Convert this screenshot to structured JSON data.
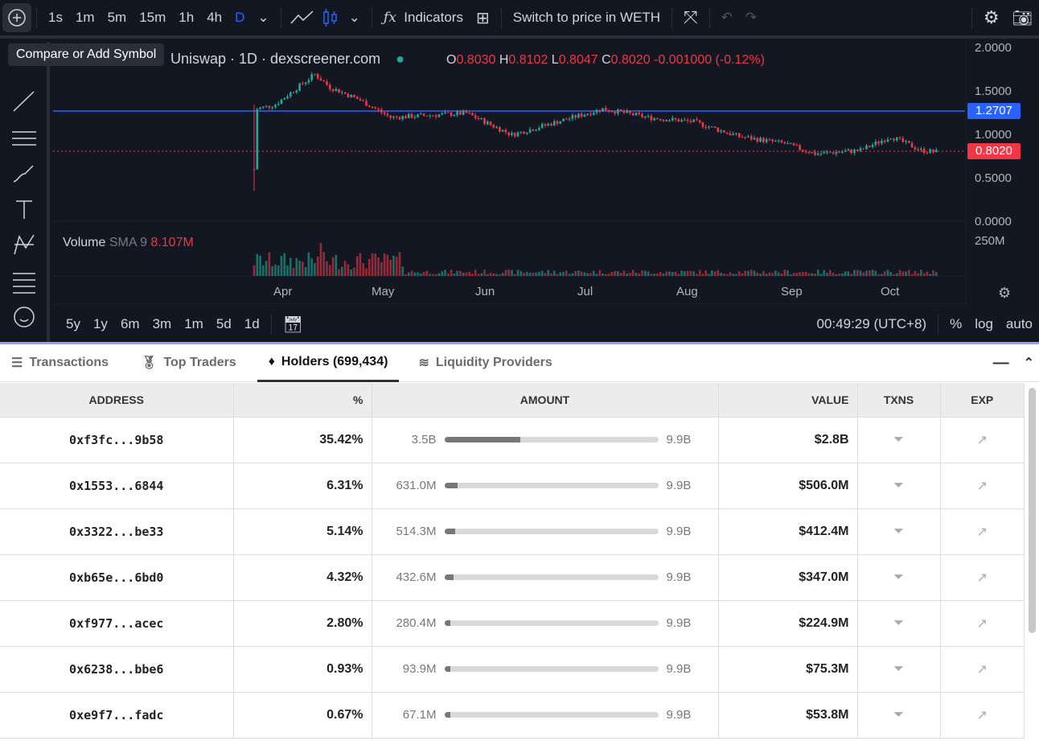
{
  "toolbar": {
    "intervals": [
      "1s",
      "1m",
      "5m",
      "15m",
      "1h",
      "4h",
      "D"
    ],
    "indicators": "Indicators",
    "switch_price": "Switch to price in WETH"
  },
  "tooltip": "Compare or Add Symbol",
  "legend": {
    "title": "Uniswap · 1D · dexscreener.com",
    "o_label": "O",
    "o": "0.8030",
    "h_label": "H",
    "h": "0.8102",
    "l_label": "L",
    "l": "0.8047",
    "c_label": "C",
    "c": "0.8020",
    "change": "-0.001000 (-0.12%)"
  },
  "price_axis": [
    "2.0000",
    "1.5000",
    "1.0000",
    "0.5000",
    "0.0000"
  ],
  "price_labels": {
    "line": "1.2707",
    "last": "0.8020"
  },
  "volume": {
    "label": "Volume",
    "sma": "SMA 9",
    "value": "8.107M",
    "axis": "250M"
  },
  "time_axis": [
    "Apr",
    "May",
    "Jun",
    "Jul",
    "Aug",
    "Sep",
    "Oct"
  ],
  "bottom_bar": {
    "ranges": [
      "5y",
      "1y",
      "6m",
      "3m",
      "1m",
      "5d",
      "1d"
    ],
    "clock": "00:49:29 (UTC+8)",
    "pct": "%",
    "log": "log",
    "auto": "auto"
  },
  "colors": {
    "up": "#26a69a",
    "down": "#f23645",
    "line": "#2962ff"
  },
  "chart_data": {
    "type": "candlestick",
    "keypoints_day_price": [
      [
        0,
        0.6
      ],
      [
        1,
        1.3
      ],
      [
        7,
        1.35
      ],
      [
        20,
        1.7
      ],
      [
        25,
        1.55
      ],
      [
        35,
        1.4
      ],
      [
        45,
        1.2
      ],
      [
        70,
        1.25
      ],
      [
        85,
        1.0
      ],
      [
        100,
        1.15
      ],
      [
        115,
        1.3
      ],
      [
        130,
        1.2
      ],
      [
        145,
        1.15
      ],
      [
        160,
        0.98
      ],
      [
        175,
        0.9
      ],
      [
        185,
        0.78
      ],
      [
        200,
        0.82
      ],
      [
        210,
        0.98
      ],
      [
        220,
        0.82
      ],
      [
        225,
        0.8
      ]
    ],
    "ylim": [
      0,
      2
    ]
  },
  "tabs": [
    {
      "label": "Transactions"
    },
    {
      "label": "Top Traders"
    },
    {
      "label": "Holders (699,434)"
    },
    {
      "label": "Liquidity Providers"
    }
  ],
  "table": {
    "headers": [
      "ADDRESS",
      "%",
      "AMOUNT",
      "VALUE",
      "TXNS",
      "EXP"
    ],
    "rows": [
      {
        "address": "0xf3fc...9b58",
        "pct": "35.42%",
        "amount": "3.5B",
        "max": "9.9B",
        "fill": 35.42,
        "value": "$2.8B"
      },
      {
        "address": "0x1553...6844",
        "pct": "6.31%",
        "amount": "631.0M",
        "max": "9.9B",
        "fill": 6.31,
        "value": "$506.0M"
      },
      {
        "address": "0x3322...be33",
        "pct": "5.14%",
        "amount": "514.3M",
        "max": "9.9B",
        "fill": 5.14,
        "value": "$412.4M"
      },
      {
        "address": "0xb65e...6bd0",
        "pct": "4.32%",
        "amount": "432.6M",
        "max": "9.9B",
        "fill": 4.32,
        "value": "$347.0M"
      },
      {
        "address": "0xf977...acec",
        "pct": "2.80%",
        "amount": "280.4M",
        "max": "9.9B",
        "fill": 2.8,
        "value": "$224.9M"
      },
      {
        "address": "0x6238...bbe6",
        "pct": "0.93%",
        "amount": "93.9M",
        "max": "9.9B",
        "fill": 0.93,
        "value": "$75.3M"
      },
      {
        "address": "0xe9f7...fadc",
        "pct": "0.67%",
        "amount": "67.1M",
        "max": "9.9B",
        "fill": 0.67,
        "value": "$53.8M"
      }
    ]
  }
}
